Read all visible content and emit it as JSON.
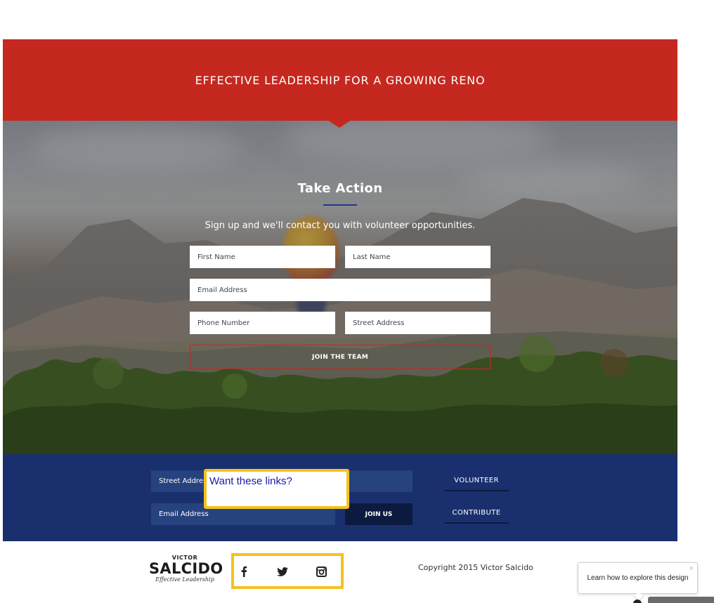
{
  "banner": {
    "title": "EFFECTIVE LEADERSHIP FOR A GROWING RENO"
  },
  "hero": {
    "heading": "Take Action",
    "subtitle": "Sign up and we'll contact you with volunteer opportunities.",
    "form": {
      "first_name_placeholder": "First Name",
      "last_name_placeholder": "Last Name",
      "email_placeholder": "Email Address",
      "phone_placeholder": "Phone Number",
      "street_placeholder": "Street Address",
      "submit_label": "JOIN THE TEAM"
    },
    "accent_color": "#c5281f",
    "divider_color": "#1e3a8a"
  },
  "band": {
    "street_placeholder": "Street Address",
    "email_placeholder": "Email Address",
    "join_label": "JOIN US",
    "links": [
      "VOLUNTEER",
      "CONTRIBUTE"
    ],
    "background_color": "#1a306e"
  },
  "tooltip": {
    "text": "Want these links?"
  },
  "footer": {
    "logo": {
      "small": "VICTOR",
      "big": "SALCIDO",
      "tagline": "Effective Leadership"
    },
    "social": [
      "facebook-icon",
      "twitter-icon",
      "instagram-icon"
    ],
    "copyright": "Copyright 2015 Victor Salcido"
  },
  "learn_popup": {
    "text": "Learn how to explore this design",
    "close": "×"
  }
}
